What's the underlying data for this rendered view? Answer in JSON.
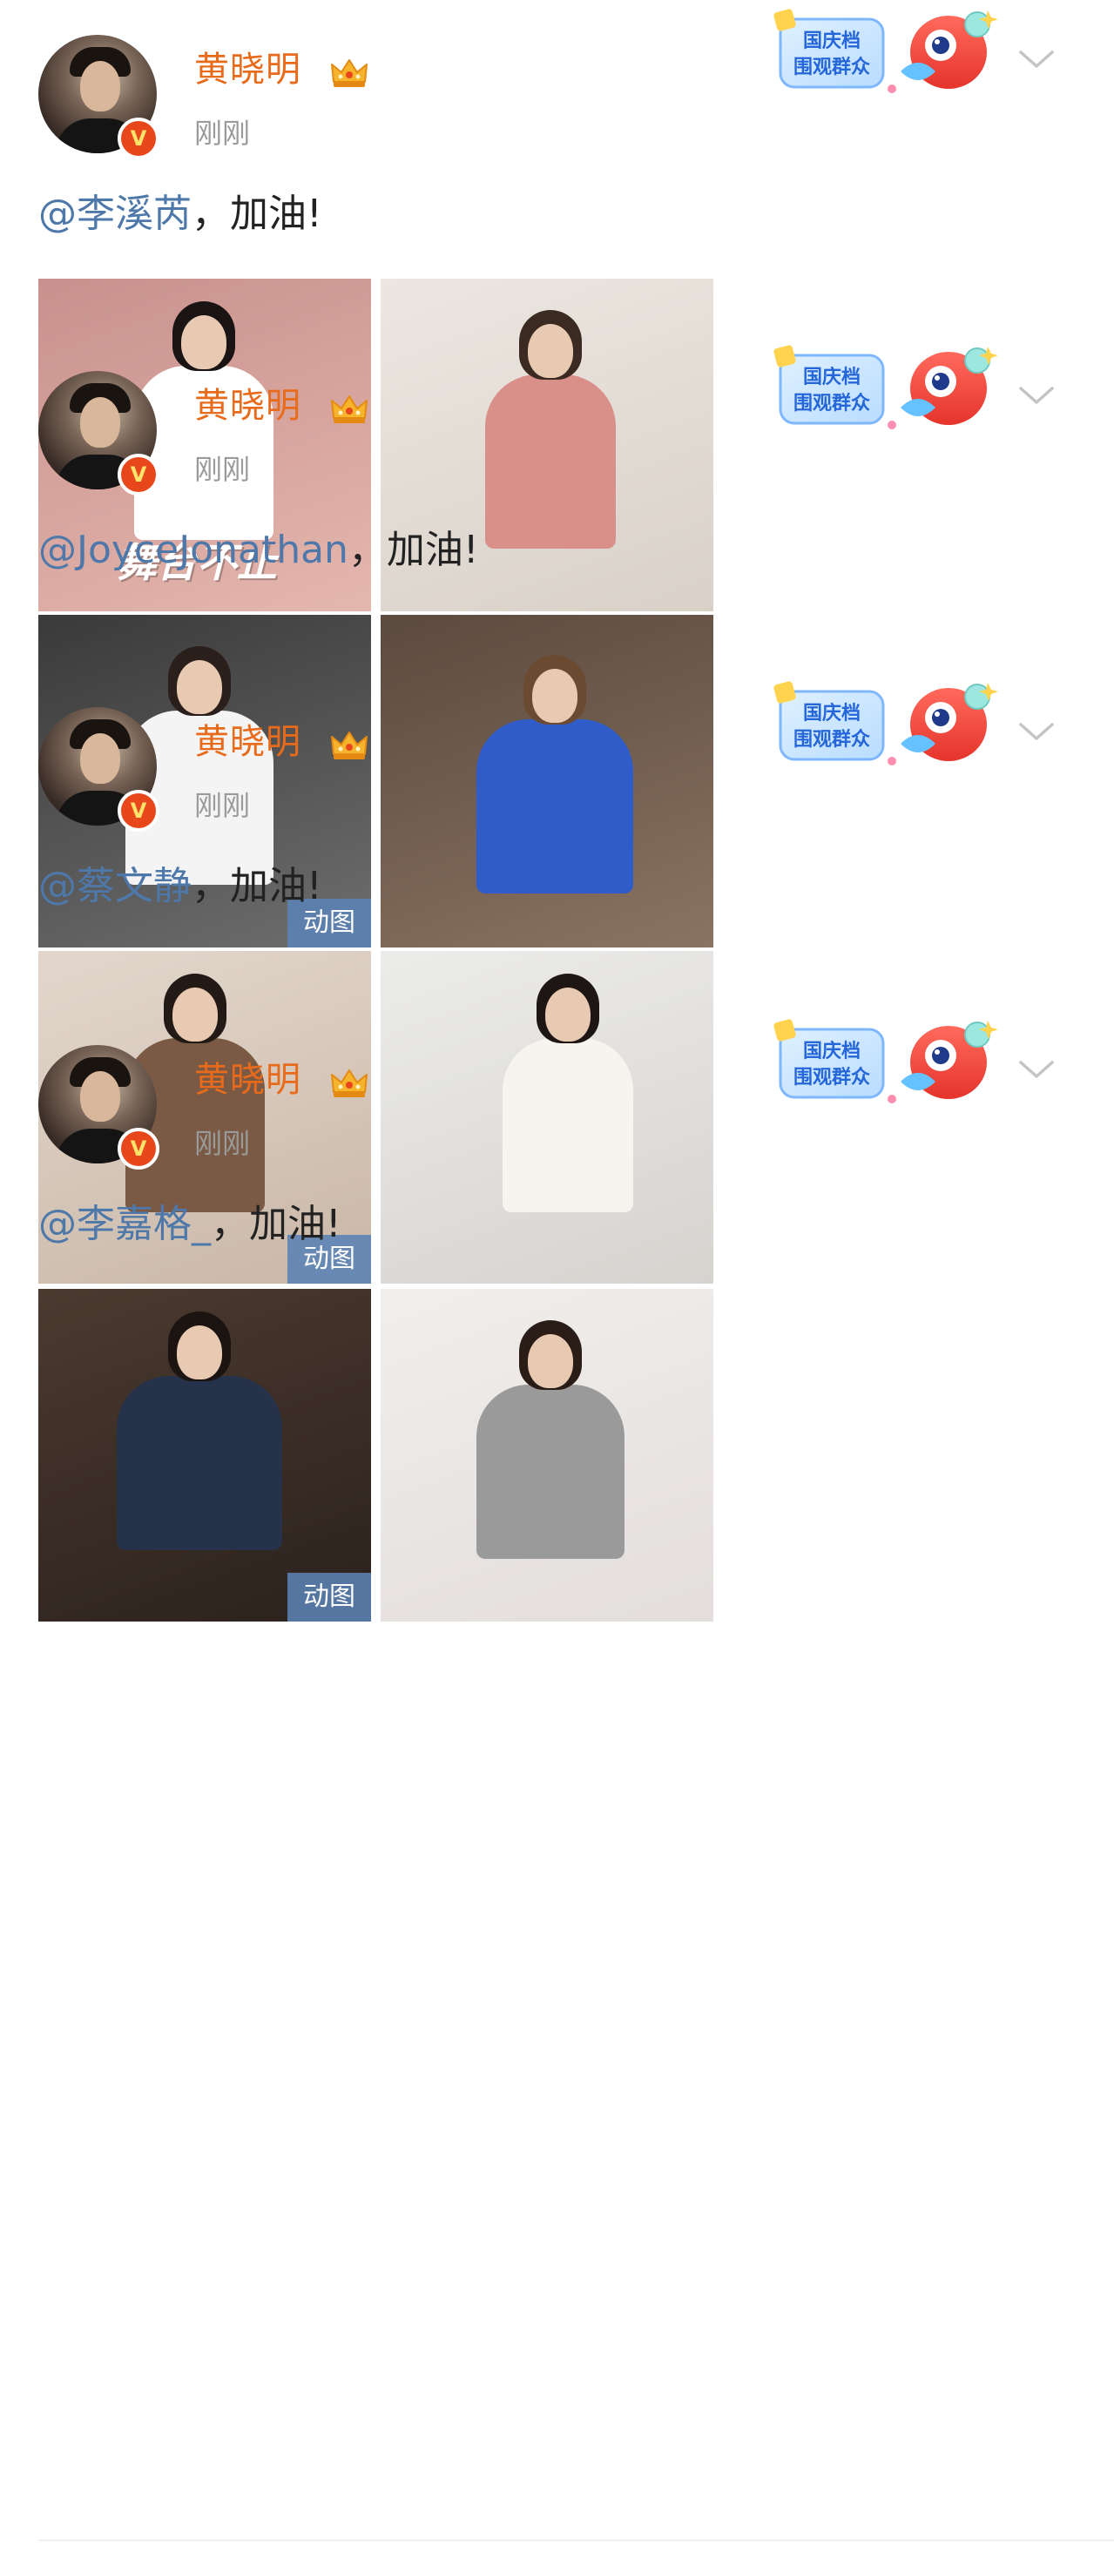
{
  "posts": [
    {
      "username": "黄晓明",
      "time": "刚刚",
      "mention": "@李溪芮",
      "suffix": "，加油!",
      "photos": [
        {
          "overlay": "舞台不止",
          "gif_label": ""
        },
        {
          "overlay": "",
          "gif_label": ""
        }
      ],
      "palette": {
        "p1": [
          "#c9918d",
          "#e4b7ae"
        ],
        "p2": [
          "#ece7e1",
          "#d9d1c8"
        ]
      }
    },
    {
      "username": "黄晓明",
      "time": "刚刚",
      "mention": "@JoyceJonathan",
      "suffix": "，加油!",
      "photos": [
        {
          "overlay": "",
          "gif_label": "动图"
        },
        {
          "overlay": "",
          "gif_label": ""
        }
      ],
      "palette": {
        "p1": [
          "#3a3a3a",
          "#6e6e6e"
        ],
        "p2": [
          "#5b4a3e",
          "#8a7361"
        ]
      }
    },
    {
      "username": "黄晓明",
      "time": "刚刚",
      "mention": "@蔡文静",
      "suffix": "，加油!",
      "photos": [
        {
          "overlay": "",
          "gif_label": "动图"
        },
        {
          "overlay": "",
          "gif_label": ""
        }
      ],
      "palette": {
        "p1": [
          "#e3d7cd",
          "#c9b7a6"
        ],
        "p2": [
          "#ececea",
          "#d6d3cf"
        ]
      }
    },
    {
      "username": "黄晓明",
      "time": "刚刚",
      "mention": "@李嘉格_",
      "suffix": "，加油!",
      "photos": [
        {
          "overlay": "",
          "gif_label": "动图"
        },
        {
          "overlay": "",
          "gif_label": ""
        }
      ],
      "palette": {
        "p1": [
          "#4b3a30",
          "#2b211c"
        ],
        "p2": [
          "#f1eeec",
          "#e3dedb"
        ]
      }
    }
  ],
  "badge": {
    "text_line1": "国庆档",
    "text_line2": "围观群众"
  },
  "colors": {
    "username": "#e86b1c",
    "mention": "#4e78a9",
    "time": "#9a9a9a",
    "verify": "#e8471c"
  },
  "icons": {
    "verify": "V",
    "crown": "crown-icon",
    "chevron": "chevron-down-icon"
  }
}
